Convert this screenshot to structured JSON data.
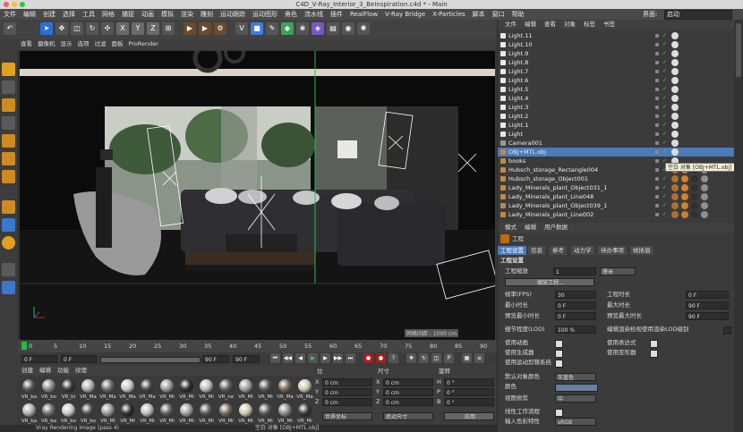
{
  "window": {
    "title": "C4D_V-Ray_Interior_3_BeInspiration.c4d * - Main"
  },
  "menubar": {
    "items": [
      "文件",
      "编辑",
      "创建",
      "选择",
      "工具",
      "网格",
      "捕捉",
      "动画",
      "模拟",
      "渲染",
      "雕刻",
      "运动跟踪",
      "运动图形",
      "角色",
      "流水线",
      "插件",
      "RealFlow",
      "V-Ray Bridge",
      "X-Particles",
      "脚本",
      "窗口",
      "帮助"
    ],
    "layout_label": "界面:",
    "layout_value": "启动"
  },
  "viewport": {
    "menu": [
      "查看",
      "摄像机",
      "显示",
      "选项",
      "过滤",
      "面板",
      "ProRender"
    ],
    "grid_label": "网格间距 : 1000 cm"
  },
  "timeline": {
    "ticks": [
      "0",
      "5",
      "10",
      "15",
      "20",
      "25",
      "30",
      "35",
      "40",
      "45",
      "50",
      "55",
      "60",
      "65",
      "70",
      "75",
      "80",
      "85",
      "90"
    ]
  },
  "transport": {
    "frame_start": "0 F",
    "frame_current": "0 F",
    "frame_end": "90 F",
    "frame_end2": "90 F"
  },
  "materials": {
    "tabs": [
      "创建",
      "编辑",
      "功能",
      "纹理"
    ],
    "row1_labels": [
      "VR_ba",
      "VR_bo",
      "VR_bl",
      "VR_Ma",
      "VR_Ma",
      "VR_Ma",
      "VR_Ma",
      "VR_Mi",
      "VR_Mi",
      "VR_Mi",
      "VR_ne",
      "VR_Mi",
      "VR_Mi",
      "VR_Ma",
      "VR_Ma"
    ],
    "row2_labels": [
      "VR_ba",
      "VR_ba",
      "VR_bo",
      "VR_bo",
      "VR_Mi",
      "VR_Mi",
      "VR_Mi",
      "VR_Mi",
      "VR_Mi",
      "VR_Mi",
      "VR_Mi",
      "VR_Mi",
      "VR_Mi",
      "VR_Mi",
      "VR_Mi"
    ]
  },
  "coords": {
    "headers": [
      "位",
      "尺寸",
      "旋转"
    ],
    "rows": [
      {
        "a": "X",
        "av": "0 cm",
        "b": "X",
        "bv": "0 cm",
        "c": "H",
        "cv": "0 °"
      },
      {
        "a": "Y",
        "av": "0 cm",
        "b": "Y",
        "bv": "0 cm",
        "c": "P",
        "cv": "0 °"
      },
      {
        "a": "Z",
        "av": "0 cm",
        "b": "Z",
        "bv": "0 cm",
        "c": "B",
        "cv": "0 °"
      }
    ],
    "mode1": "世界坐标",
    "mode2": "绝对尺寸",
    "apply": "应用"
  },
  "status": {
    "left": "Vray Rendering image (pass 4)",
    "right": "空白 对象 [OBJ+MTL.obj]"
  },
  "object_manager": {
    "menu": [
      "文件",
      "编辑",
      "查看",
      "对象",
      "标签",
      "书签"
    ],
    "items": [
      "Light.11",
      "Light.10",
      "Light.9",
      "Light.8",
      "Light.7",
      "Light.6",
      "Light.5",
      "Light.4",
      "Light.3",
      "Light.2",
      "Light.1",
      "Light",
      "Camera001",
      "OBJ+MTL.obj",
      "books",
      "Hubsch_storage_Rectangle004",
      "Hubsch_storage_Object001",
      "Lady_Minerals_plant_Object031_1",
      "Lady_Minerals_plant_Line048",
      "Lady_Minerals_plant_Object039_1",
      "Lady_Minerals_plant_Line002"
    ],
    "tooltip": "空白 对象 [OBJ+MTL.obj]"
  },
  "attributes": {
    "menu": [
      "模式",
      "编辑",
      "用户数据"
    ],
    "section": "工程",
    "tabs": [
      "工程设置",
      "信息",
      "参考",
      "动力学",
      "待办事项",
      "帧插值"
    ],
    "group_title": "工程设置",
    "scale_label": "工程缩放",
    "scale_value": "1",
    "scale_unit": "厘米",
    "scale_button": "缩放工程...",
    "fps_label": "帧率(FPS)",
    "fps_value": "30",
    "duration_label": "工程时长",
    "duration_value": "0 F",
    "min_label": "最小时长",
    "min_value": "0 F",
    "max_label": "最大时长",
    "max_value": "90 F",
    "pmin_label": "预览最小时长",
    "pmin_value": "0 F",
    "pmax_label": "预览最大时长",
    "pmax_value": "90 F",
    "lod_label": "细节程度(LOD)",
    "lod_value": "100 %",
    "lod_check": "编辑渲染检视使用渲染LOD级别",
    "checks_left": [
      "使用动画",
      "使用生成器",
      "使用运动剪辑系统"
    ],
    "checks_right": [
      "使用表达式",
      "使用变形器"
    ],
    "color_label": "默认对象颜色",
    "color_value": "灰蓝色",
    "color2_label": "颜色",
    "view_label": "视图修剪",
    "view_value": "中",
    "linear_label": "线性工作流程",
    "input_label": "输入色彩特性",
    "input_value": "sRGB"
  },
  "colors": {
    "accent": "#f0a000",
    "selection": "#4c7bb8"
  }
}
